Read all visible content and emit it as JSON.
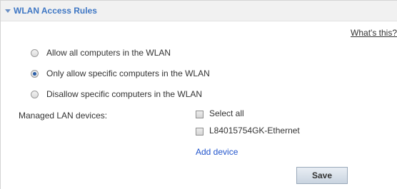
{
  "panel": {
    "title": "WLAN Access Rules",
    "help_link": "What's this?"
  },
  "access_options": [
    {
      "label": "Allow all computers in the WLAN",
      "checked": false
    },
    {
      "label": "Only allow specific computers in the WLAN",
      "checked": true
    },
    {
      "label": "Disallow specific computers in the WLAN",
      "checked": false
    }
  ],
  "managed_devices": {
    "label": "Managed LAN devices:",
    "select_all_label": "Select all",
    "devices": [
      {
        "label": "L84015754GK-Ethernet",
        "checked": false
      }
    ],
    "add_device_label": "Add device"
  },
  "actions": {
    "save_label": "Save"
  }
}
